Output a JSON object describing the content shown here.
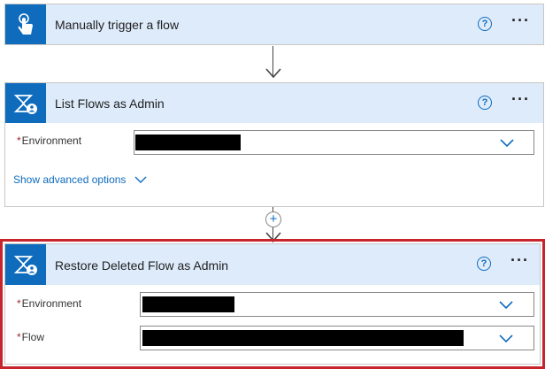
{
  "trigger_card": {
    "title": "Manually trigger a flow",
    "help_icon": "help-circle-icon",
    "more_icon": "more-ellipsis-icon",
    "icon": "touch-hand-icon"
  },
  "list_card": {
    "title": "List Flows as Admin",
    "icon": "power-automate-admin-icon",
    "environment": {
      "label": "Environment",
      "required_mark": "*",
      "value": "",
      "redacted": true
    },
    "show_advanced": "Show advanced options"
  },
  "restore_card": {
    "title": "Restore Deleted Flow as Admin",
    "icon": "power-automate-admin-icon",
    "highlight_color": "#c7252d",
    "environment": {
      "label": "Environment",
      "required_mark": "*",
      "value": "",
      "redacted": true
    },
    "flow": {
      "label": "Flow",
      "required_mark": "*",
      "value": "",
      "redacted": true
    }
  },
  "add_step_icon": "plus-icon",
  "colors": {
    "accent": "#0f6cbd",
    "header_bg": "#deebfb",
    "required": "#a4262c"
  }
}
